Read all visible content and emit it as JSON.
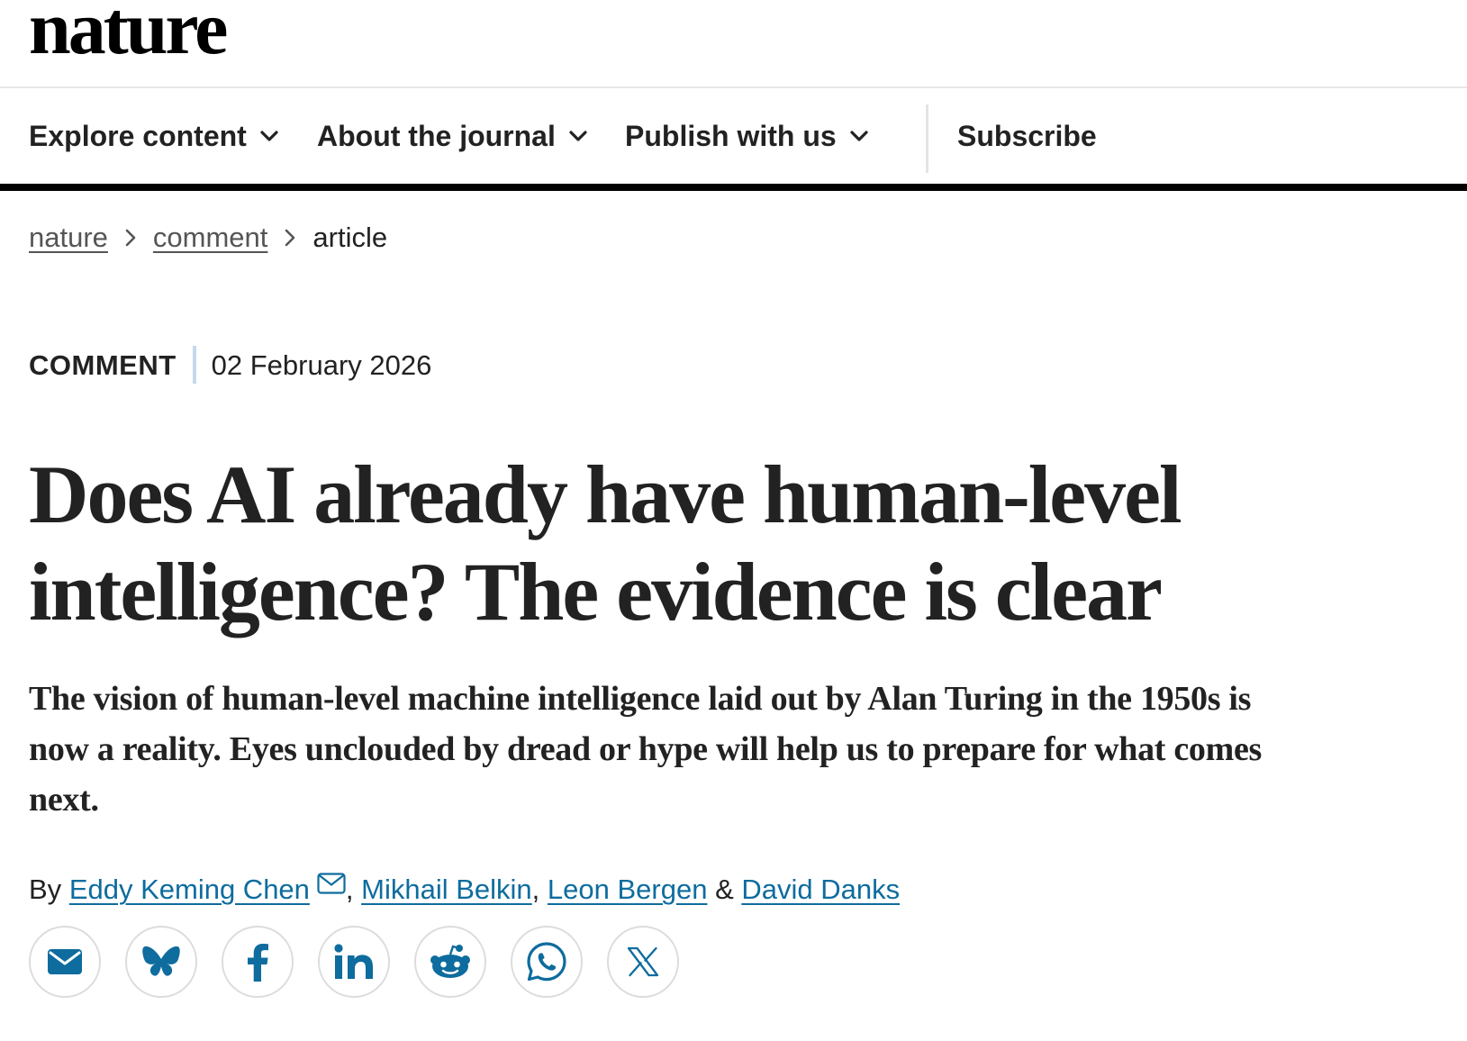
{
  "site": {
    "logo": "nature"
  },
  "nav": {
    "items": [
      {
        "label": "Explore content"
      },
      {
        "label": "About the journal"
      },
      {
        "label": "Publish with us"
      }
    ],
    "subscribe": "Subscribe"
  },
  "breadcrumb": [
    "nature",
    "comment",
    "article"
  ],
  "article": {
    "type": "COMMENT",
    "date": "02 February 2026",
    "title": "Does AI already have human-level intelligence? The evidence is clear",
    "standfirst": "The vision of human-level machine intelligence laid out by Alan Turing in the 1950s is now a reality. Eyes unclouded by dread or hype will help us to prepare for what comes next.",
    "byline_prefix": "By",
    "authors": [
      "Eddy Keming Chen",
      "Mikhail Belkin",
      "Leon Bergen",
      "David Danks"
    ],
    "author_separators": [
      ", ",
      ", ",
      " & "
    ]
  },
  "share": {
    "icons": [
      "email-icon",
      "bluesky-icon",
      "facebook-icon",
      "linkedin-icon",
      "reddit-icon",
      "whatsapp-icon",
      "x-icon"
    ]
  },
  "colors": {
    "text": "#222222",
    "link": "#0e6c9e",
    "icon": "#0e6c9e",
    "nav_rule": "#000000",
    "meta_divider": "#c5d9ea"
  }
}
